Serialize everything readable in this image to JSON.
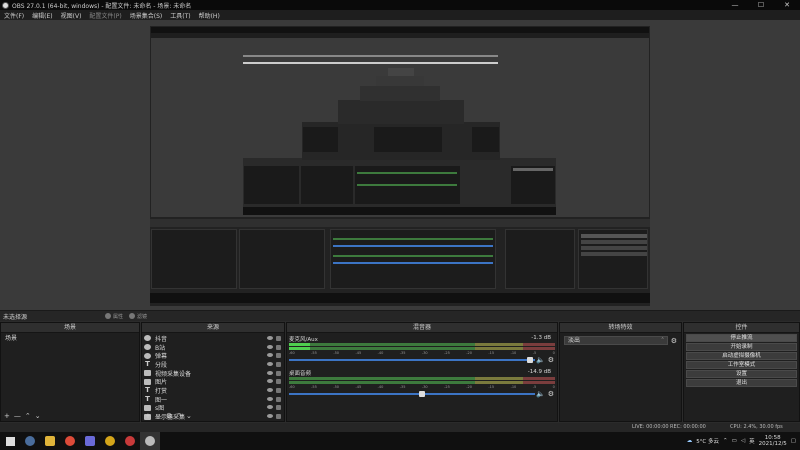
{
  "window": {
    "title": "OBS 27.0.1 (64-bit, windows) - 配置文件: 未命名 - 场景: 未命名",
    "controls": [
      "—",
      "☐",
      "✕"
    ]
  },
  "menu": [
    "文件(F)",
    "编辑(E)",
    "视图(V)",
    "配置文件(P)",
    "场景集合(S)",
    "工具(T)",
    "帮助(H)"
  ],
  "scene_bar": {
    "label": "未选择源",
    "properties": "属性",
    "filters": "滤镜"
  },
  "scenes": {
    "header": "场景",
    "items": [
      "场景"
    ]
  },
  "sources": {
    "header": "来源",
    "items": [
      {
        "label": "抖音",
        "icon": "browser-icon"
      },
      {
        "label": "B站",
        "icon": "browser-icon"
      },
      {
        "label": "弹幕",
        "icon": "browser-icon"
      },
      {
        "label": "分段",
        "icon": "text-icon"
      },
      {
        "label": "视频采集设备",
        "icon": "camera-icon"
      },
      {
        "label": "图片",
        "icon": "image-icon"
      },
      {
        "label": "打赏",
        "icon": "text-icon"
      },
      {
        "label": "图一",
        "icon": "text-icon"
      },
      {
        "label": "s图",
        "icon": "image-icon"
      },
      {
        "label": "显示器采集",
        "icon": "monitor-icon"
      }
    ]
  },
  "mixer": {
    "header": "混音器",
    "channels": [
      {
        "name": "麦克风/Aux",
        "db": "-1.3 dB",
        "level": 0.08,
        "volume": 0.98
      },
      {
        "name": "桌面音频",
        "db": "-14.9 dB",
        "level": 0.0,
        "volume": 0.54
      }
    ],
    "ticks": [
      "-60",
      "-55",
      "-50",
      "-45",
      "-40",
      "-35",
      "-30",
      "-25",
      "-20",
      "-15",
      "-10",
      "-5",
      "0"
    ]
  },
  "transitions": {
    "header": "转场特效",
    "selected": "淡出"
  },
  "controls": {
    "header": "控件",
    "buttons": [
      "停止推流",
      "开始录制",
      "启动虚拟摄像机",
      "工作室模式",
      "设置",
      "退出"
    ]
  },
  "status": {
    "live": "LIVE: 00:00:00",
    "rec": "REC: 00:00:00",
    "cpu": "CPU: 2.4%, 30.00 fps"
  },
  "taskbar": {
    "weather": "5°C 多云",
    "lang": "英",
    "time": "10:58",
    "date": "2021/12/5",
    "colors": {
      "steam": "#4a6d9c",
      "chrome": "#e0b43a",
      "app3": "#6a6ad8",
      "app4": "#d4a51a",
      "app5": "#c83a3a",
      "obs": "#3a3a3a"
    }
  }
}
